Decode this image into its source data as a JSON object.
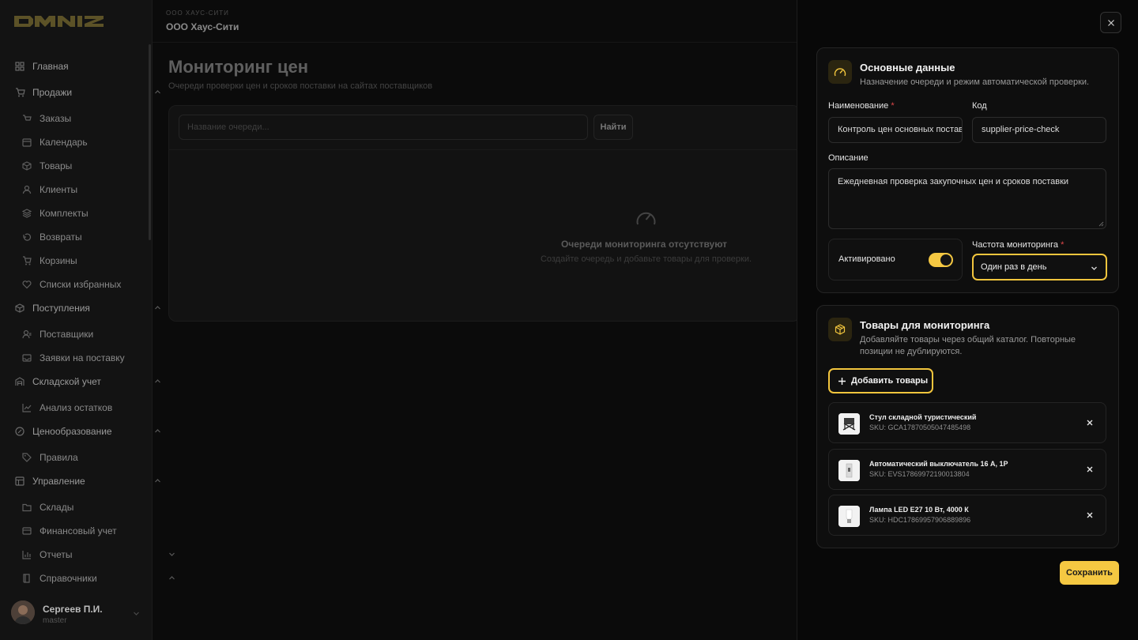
{
  "app": {
    "logo_text": "OMNIZ"
  },
  "sidebar": {
    "items": [
      {
        "label": "Главная",
        "icon": "home-icon"
      },
      {
        "label": "Продажи",
        "icon": "cart-icon"
      },
      {
        "label": "Заказы",
        "icon": "order-icon"
      },
      {
        "label": "Календарь",
        "icon": "calendar-icon"
      },
      {
        "label": "Товары",
        "icon": "box-icon"
      },
      {
        "label": "Клиенты",
        "icon": "user-icon"
      },
      {
        "label": "Комплекты",
        "icon": "layers-icon"
      },
      {
        "label": "Возвраты",
        "icon": "return-icon"
      },
      {
        "label": "Корзины",
        "icon": "basket-icon"
      },
      {
        "label": "Списки избранных",
        "icon": "heart-icon"
      },
      {
        "label": "Поступления",
        "icon": "package-icon"
      },
      {
        "label": "Поставщики",
        "icon": "supplier-icon"
      },
      {
        "label": "Заявки на поставку",
        "icon": "inbox-icon"
      },
      {
        "label": "Складской учет",
        "icon": "warehouse-icon"
      },
      {
        "label": "Анализ остатков",
        "icon": "chart-icon"
      },
      {
        "label": "Ценообразование",
        "icon": "percent-icon"
      },
      {
        "label": "Правила",
        "icon": "tag-icon"
      },
      {
        "label": "Управление",
        "icon": "panel-icon"
      },
      {
        "label": "Склады",
        "icon": "folder-icon"
      },
      {
        "label": "Финансовый учет",
        "icon": "wallet-icon"
      },
      {
        "label": "Отчеты",
        "icon": "bar-chart-icon"
      },
      {
        "label": "Справочники",
        "icon": "book-icon"
      }
    ],
    "user": {
      "name": "Сергеев П.И.",
      "role": "master"
    }
  },
  "topbar": {
    "org_small": "ООО ХАУС-СИТИ",
    "org": "ООО Хаус-Сити"
  },
  "page": {
    "title": "Мониторинг цен",
    "subtitle": "Очереди проверки цен и сроков поставки на сайтах поставщиков",
    "search_placeholder": "Название очереди...",
    "search_button": "Найти",
    "empty_title": "Очереди мониторинга отсутствуют",
    "empty_subtitle": "Создайте очередь и добавьте товары для проверки."
  },
  "panel": {
    "close_icon": "close-icon",
    "main": {
      "title": "Основные данные",
      "description": "Назначение очереди и режим автоматической проверки.",
      "name_label": "Наименование",
      "required_mark": "*",
      "name_value": "Контроль цен основных поставщиков",
      "code_label": "Код",
      "code_value": "supplier-price-check",
      "description_label": "Описание",
      "description_value": "Ежедневная проверка закупочных цен и сроков поставки",
      "active_label": "Активировано",
      "active": true,
      "frequency_label": "Частота мониторинга",
      "frequency_value": "Один раз в день"
    },
    "products": {
      "title": "Товары для мониторинга",
      "description": "Добавляйте товары через общий каталог. Повторные позиции не дублируются.",
      "add_button": "Добавить товары",
      "items": [
        {
          "name": "Стул складной туристический",
          "sku": "SKU: GCA17870505047485498"
        },
        {
          "name": "Автоматический выключатель 16 А, 1P",
          "sku": "SKU: EVS17869972190013804"
        },
        {
          "name": "Лампа LED E27 10 Вт, 4000 К",
          "sku": "SKU: HDC17869957906889896"
        }
      ]
    },
    "save_button": "Сохранить"
  },
  "colors": {
    "accent": "#f5c842",
    "background": "#0b0b0b",
    "panel": "#080808"
  }
}
